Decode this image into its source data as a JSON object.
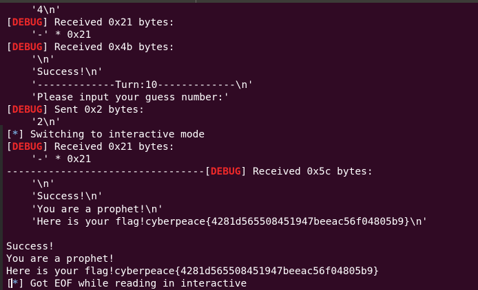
{
  "tags": {
    "debug": "DEBUG",
    "info": "*"
  },
  "lines": [
    {
      "kind": "indent",
      "text": "'4\\n'"
    },
    {
      "kind": "debug",
      "text": " Received 0x21 bytes:"
    },
    {
      "kind": "indent",
      "text": "'-' * 0x21"
    },
    {
      "kind": "debug",
      "text": " Received 0x4b bytes:"
    },
    {
      "kind": "indent",
      "text": "'\\n'"
    },
    {
      "kind": "indent",
      "text": "'Success!\\n'"
    },
    {
      "kind": "indent",
      "text": "'-------------Turn:10-------------\\n'"
    },
    {
      "kind": "indent",
      "text": "'Please input your guess number:'"
    },
    {
      "kind": "debug",
      "text": " Sent 0x2 bytes:"
    },
    {
      "kind": "indent",
      "text": "'2\\n'"
    },
    {
      "kind": "info",
      "text": " Switching to interactive mode"
    },
    {
      "kind": "debug",
      "text": " Received 0x21 bytes:"
    },
    {
      "kind": "indent",
      "text": "'-' * 0x21"
    },
    {
      "kind": "dash-debug",
      "prefix": "---------------------------------",
      "text": " Received 0x5c bytes:"
    },
    {
      "kind": "indent",
      "text": "'\\n'"
    },
    {
      "kind": "indent",
      "text": "'Success!\\n'"
    },
    {
      "kind": "indent",
      "text": "'You are a prophet!\\n'"
    },
    {
      "kind": "indent",
      "text": "'Here is your flag!cyberpeace{4281d565508451947beeac56f04805b9}\\n'"
    },
    {
      "kind": "blank",
      "text": ""
    },
    {
      "kind": "plain",
      "text": "Success!"
    },
    {
      "kind": "plain",
      "text": "You are a prophet!"
    },
    {
      "kind": "plain",
      "text": "Here is your flag!cyberpeace{4281d565508451947beeac56f04805b9}"
    },
    {
      "kind": "info",
      "text": " Got EOF while reading in interactive"
    }
  ],
  "colors": {
    "background": "#300a24",
    "debug_tag": "#ef2929",
    "info_tag": "#729fcf",
    "text": "#ffffff"
  }
}
